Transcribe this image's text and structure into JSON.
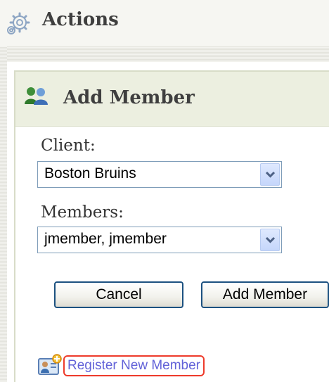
{
  "actions": {
    "title": "Actions",
    "icon": "gear-icon"
  },
  "panel": {
    "title": "Add Member",
    "icon": "users-icon"
  },
  "client": {
    "label": "Client:",
    "selected": "Boston Bruins"
  },
  "members": {
    "label": "Members:",
    "selected": "jmember, jmember"
  },
  "buttons": {
    "cancel": "Cancel",
    "add_member": "Add Member"
  },
  "register": {
    "label": "Register New Member",
    "icon": "id-card-icon"
  },
  "colors": {
    "panel_header_bg": "#ecefe0",
    "link": "#6262d8",
    "highlight": "#ee3b2b",
    "button_border": "#1c5180",
    "select_border": "#7f9db9"
  }
}
